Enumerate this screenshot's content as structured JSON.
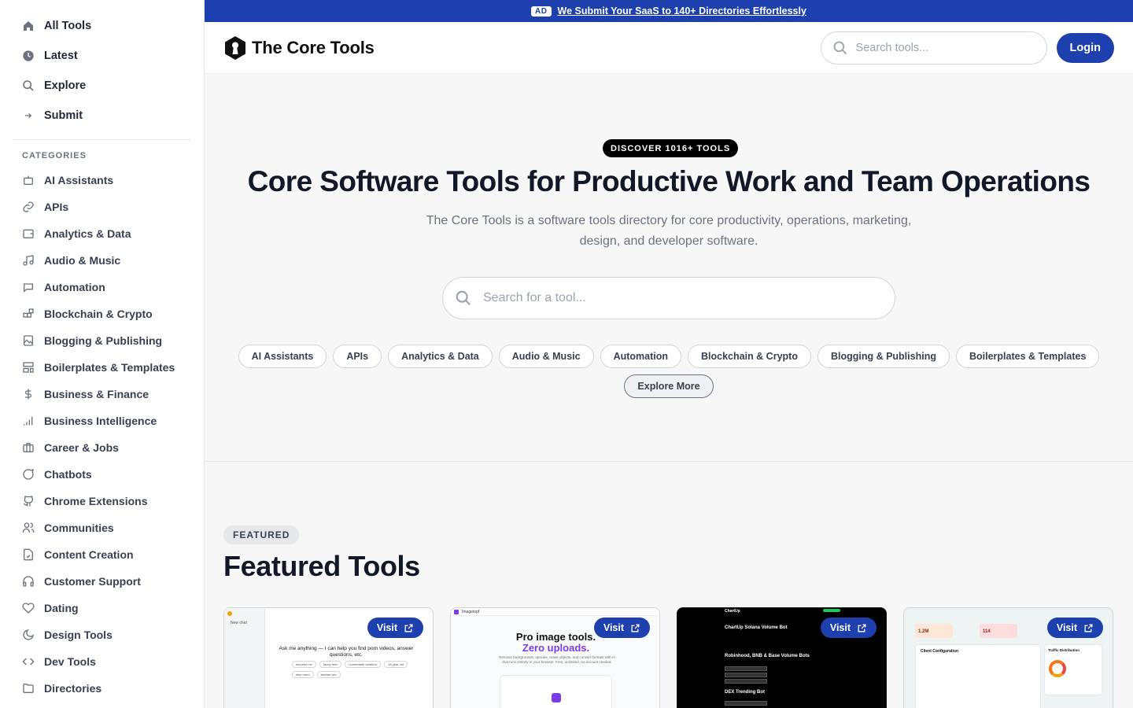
{
  "sidebar": {
    "main": [
      {
        "label": "All Tools",
        "icon": "home-icon"
      },
      {
        "label": "Latest",
        "icon": "clock-icon"
      },
      {
        "label": "Explore",
        "icon": "search-icon"
      },
      {
        "label": "Submit",
        "icon": "arrow-right-icon"
      }
    ],
    "categories_heading": "CATEGORIES",
    "categories": [
      {
        "label": "AI Assistants",
        "icon": "bot-icon"
      },
      {
        "label": "APIs",
        "icon": "link-icon"
      },
      {
        "label": "Analytics & Data",
        "icon": "wallet-icon"
      },
      {
        "label": "Audio & Music",
        "icon": "music-icon"
      },
      {
        "label": "Automation",
        "icon": "bot-message-icon"
      },
      {
        "label": "Blockchain & Crypto",
        "icon": "blocks-icon"
      },
      {
        "label": "Blogging & Publishing",
        "icon": "image-icon"
      },
      {
        "label": "Boilerplates & Templates",
        "icon": "layout-template-icon"
      },
      {
        "label": "Business & Finance",
        "icon": "dollar-icon"
      },
      {
        "label": "Business Intelligence",
        "icon": "signal-icon"
      },
      {
        "label": "Career & Jobs",
        "icon": "briefcase-icon"
      },
      {
        "label": "Chatbots",
        "icon": "message-circle-icon"
      },
      {
        "label": "Chrome Extensions",
        "icon": "github-icon"
      },
      {
        "label": "Communities",
        "icon": "users-icon"
      },
      {
        "label": "Content Creation",
        "icon": "file-check-icon"
      },
      {
        "label": "Customer Support",
        "icon": "headphones-icon"
      },
      {
        "label": "Dating",
        "icon": "heart-icon"
      },
      {
        "label": "Design Tools",
        "icon": "moon-icon"
      },
      {
        "label": "Dev Tools",
        "icon": "code-icon"
      },
      {
        "label": "Directories",
        "icon": "folder-icon"
      }
    ]
  },
  "ad": {
    "badge": "AD",
    "text": "We Submit Your SaaS to 140+ Directories Effortlessly"
  },
  "header": {
    "logo_text": "The Core Tools",
    "search_placeholder": "Search tools...",
    "login_label": "Login"
  },
  "hero": {
    "badge": "DISCOVER 1016+ TOOLS",
    "title": "Core Software Tools for Productive Work and Team Operations",
    "subtitle_line1": "The Core Tools is a software tools directory for core productivity, operations, marketing,",
    "subtitle_line2": "design, and developer software.",
    "search_placeholder": "Search for a tool...",
    "chips": [
      "AI Assistants",
      "APIs",
      "Analytics & Data",
      "Audio & Music",
      "Automation",
      "Blockchain & Crypto",
      "Blogging & Publishing",
      "Boilerplates & Templates"
    ],
    "explore_label": "Explore More"
  },
  "featured": {
    "badge": "FEATURED",
    "title": "Featured Tools",
    "visit_label": "Visit",
    "card1": {
      "new_chat": "New chat",
      "prompt": "Ask me anything — I can help you find porn videos, answer questions, etc.",
      "pills": [
        "surprise me",
        "fancy teen",
        "homemade amateur",
        "18 year old",
        "step mom",
        "lesbian sex"
      ]
    },
    "card2": {
      "brand": "Imagetopf",
      "headline1": "Pro image tools.",
      "headline2": "Zero uploads.",
      "desc": "Remove backgrounds, upscale, erase objects, and convert formats with AI that runs entirely in your browser. Free, unlimited, no account needed."
    },
    "card3": {
      "brand": "ChartUp",
      "title": "ChartUp Solana Volume Bot",
      "section1": "Robinhood, BNB & Base Volume Bots",
      "section2": "DEX Trending Bot"
    },
    "card4": {
      "panel_title": "Client Configuration",
      "side_title": "Traffic Distribution",
      "stats": [
        "1.2M",
        "114"
      ]
    }
  }
}
